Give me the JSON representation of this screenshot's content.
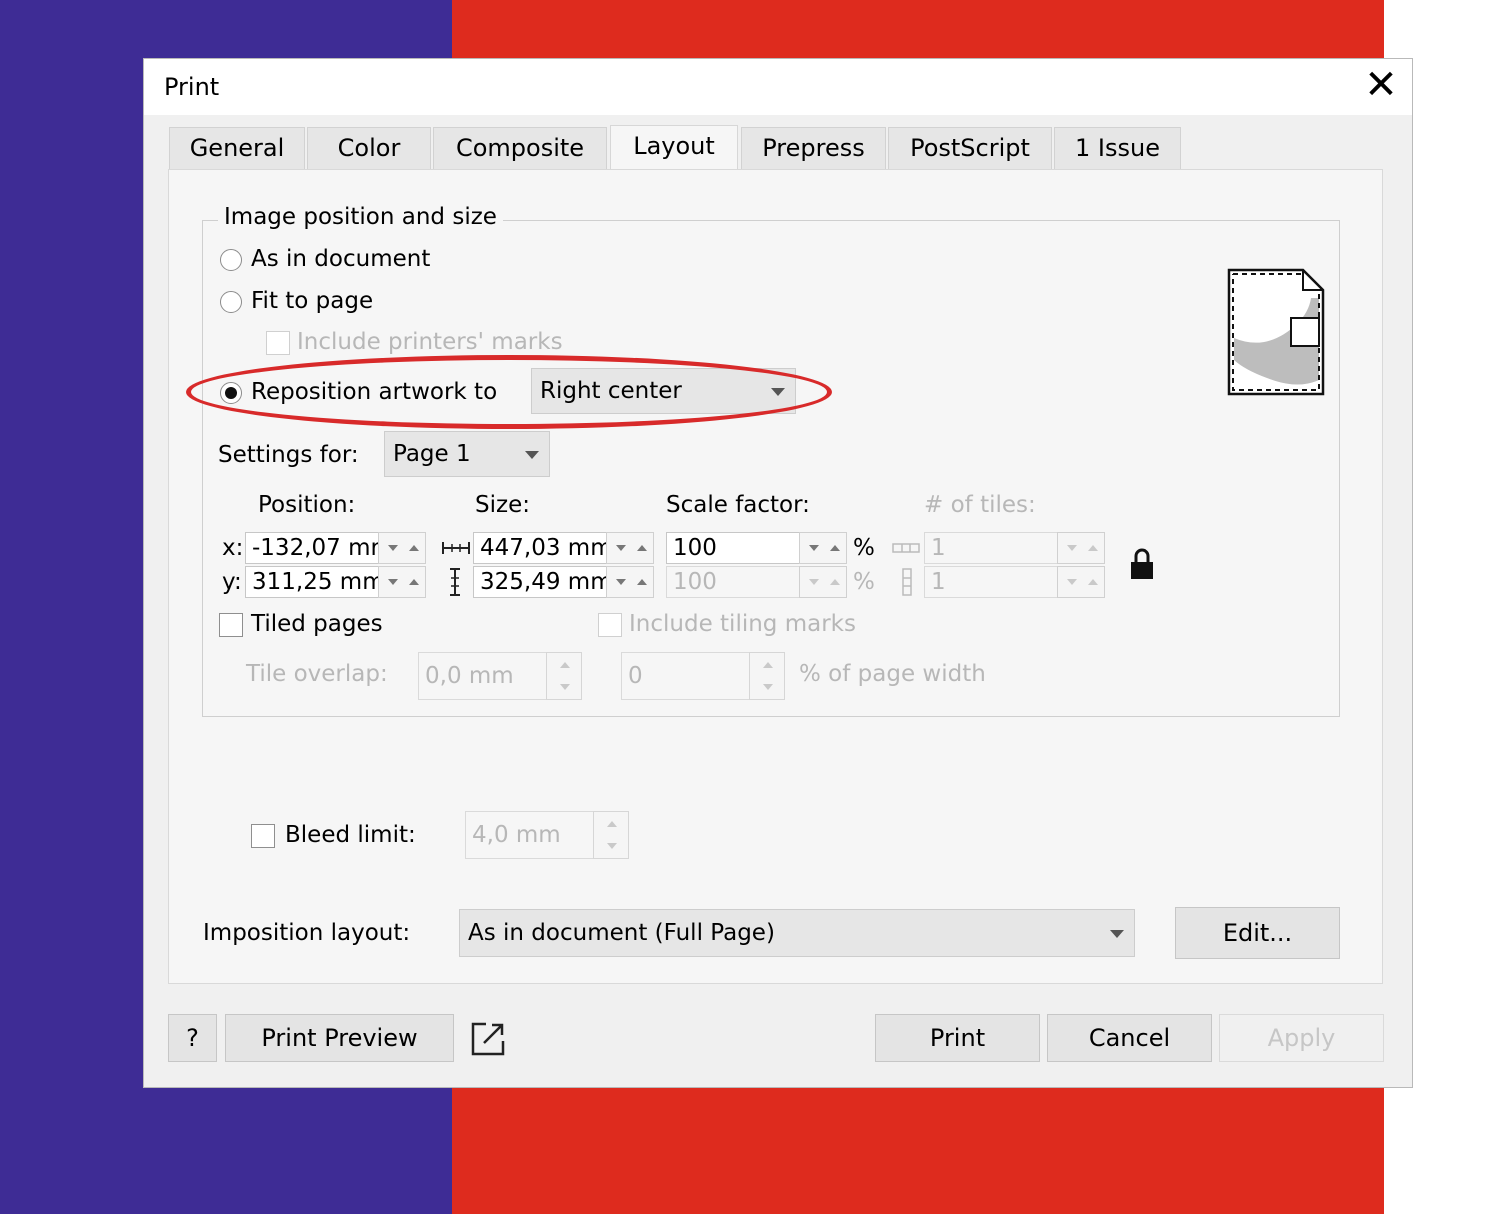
{
  "dialog": {
    "title": "Print",
    "close_symbol": "✕"
  },
  "tabs": [
    {
      "label": "General"
    },
    {
      "label": "Color"
    },
    {
      "label": "Composite"
    },
    {
      "label": "Layout",
      "active": true
    },
    {
      "label": "Prepress"
    },
    {
      "label": "PostScript"
    },
    {
      "label": "1 Issue"
    }
  ],
  "image_position": {
    "group_label": "Image position and size",
    "as_in_document": "As in document",
    "fit_to_page": "Fit to page",
    "include_printers_marks": "Include printers' marks",
    "reposition_label": "Reposition artwork to",
    "reposition_value": "Right center",
    "settings_for_label": "Settings for:",
    "settings_for_value": "Page 1",
    "selected_option": "reposition"
  },
  "position": {
    "header": "Position:",
    "x_label": "x:",
    "y_label": "y:",
    "x_value": "-132,07 mr",
    "y_value": "311,25 mm"
  },
  "size": {
    "header": "Size:",
    "width_value": "447,03 mm",
    "height_value": "325,49 mm"
  },
  "scale": {
    "header": "Scale factor:",
    "x_value": "100",
    "y_value": "100",
    "unit": "%"
  },
  "tiles": {
    "header": "# of tiles:",
    "x_value": "1",
    "y_value": "1"
  },
  "tiling": {
    "tiled_pages": "Tiled pages",
    "include_tiling_marks": "Include tiling marks",
    "tile_overlap_label": "Tile overlap:",
    "tile_overlap_value": "0,0 mm",
    "tile_overlap_percent": "0",
    "percent_label": "% of page width"
  },
  "bleed": {
    "label": "Bleed limit:",
    "value": "4,0 mm"
  },
  "imposition": {
    "label": "Imposition layout:",
    "value": "As in document (Full Page)",
    "edit_button": "Edit..."
  },
  "footer": {
    "help_button": "?",
    "print_preview_button": "Print Preview",
    "print_button": "Print",
    "cancel_button": "Cancel",
    "apply_button": "Apply"
  },
  "colors": {
    "background_left": "#3e2c95",
    "background_right": "#de2b1e",
    "highlight": "#d82a2a"
  }
}
